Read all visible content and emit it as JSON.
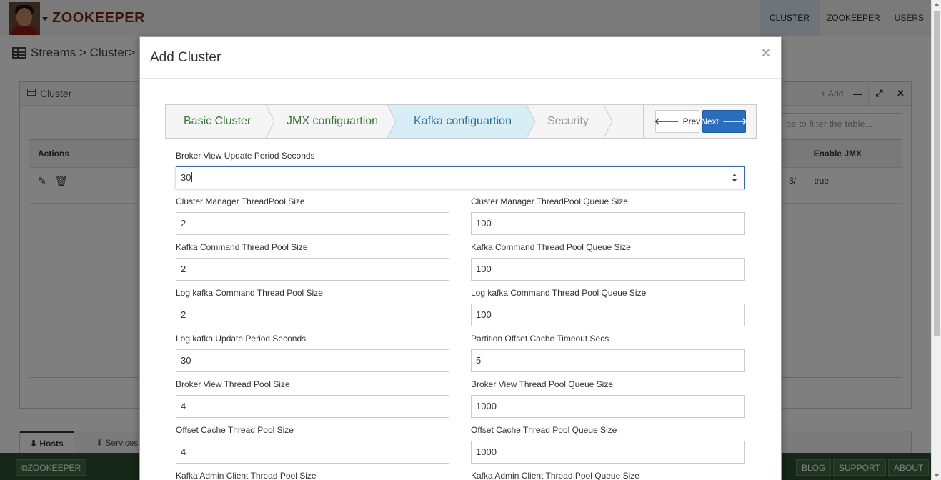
{
  "app": {
    "brand": "ZOOKEEPER",
    "accent": "#7a2b16"
  },
  "topnav": [
    "CLUSTER",
    "ZOOKEEPER",
    "USERS"
  ],
  "breadcrumb": "Streams > Cluster> Clus",
  "panel": {
    "title": "Cluster",
    "add_label": "Add",
    "filter_placeholder": "Type to filter the table...",
    "filter_visible": "pe to filter the table..."
  },
  "table": {
    "col_actions": "Actions",
    "col_jmx": "Enable JMX",
    "row_jmx": "true",
    "row_frag": "3/"
  },
  "bottom_tabs": {
    "hosts": "Hosts",
    "services": "Services"
  },
  "footer": {
    "zk": "ZOOKEEPER",
    "blog": "BLOG",
    "support": "SUPPORT",
    "about": "ABOUT"
  },
  "modal": {
    "title": "Add Cluster",
    "close": "×",
    "steps": [
      {
        "label": "Basic Cluster",
        "state": "done"
      },
      {
        "label": "JMX configuartion",
        "state": "done"
      },
      {
        "label": "Kafka configuartion",
        "state": "current"
      },
      {
        "label": "Security",
        "state": "todo"
      }
    ],
    "prev_label": "Prev",
    "next_label": "Next",
    "fields": {
      "broker_view_update": {
        "label": "Broker View Update Period Seconds",
        "value": "30"
      },
      "cm_pool_size": {
        "label": "Cluster Manager ThreadPool Size",
        "value": "2"
      },
      "cm_pool_queue": {
        "label": "Cluster Manager ThreadPool Queue Size",
        "value": "100"
      },
      "kc_pool_size": {
        "label": "Kafka Command Thread Pool Size",
        "value": "2"
      },
      "kc_pool_queue": {
        "label": "Kafka Command Thread Pool Queue Size",
        "value": "100"
      },
      "lkc_pool_size": {
        "label": "Log kafka Command Thread Pool Size",
        "value": "2"
      },
      "lkc_pool_queue": {
        "label": "Log kafka Command Thread Pool Queue Size",
        "value": "100"
      },
      "lk_update": {
        "label": "Log kafka Update Period Seconds",
        "value": "30"
      },
      "poc_timeout": {
        "label": "Partition Offset Cache Timeout Secs",
        "value": "5"
      },
      "bv_pool_size": {
        "label": "Broker View Thread Pool Size",
        "value": "4"
      },
      "bv_pool_queue": {
        "label": "Broker View Thread Pool Queue Size",
        "value": "1000"
      },
      "oc_pool_size": {
        "label": "Offset Cache Thread Pool Size",
        "value": "4"
      },
      "oc_pool_queue": {
        "label": "Offset Cache Thread Pool Queue Size",
        "value": "1000"
      },
      "kac_pool_size": {
        "label": "Kafka Admin Client Thread Pool Size",
        "value": ""
      },
      "kac_pool_queue": {
        "label": "Kafka Admin Client Thread Pool Queue Size",
        "value": ""
      }
    }
  }
}
